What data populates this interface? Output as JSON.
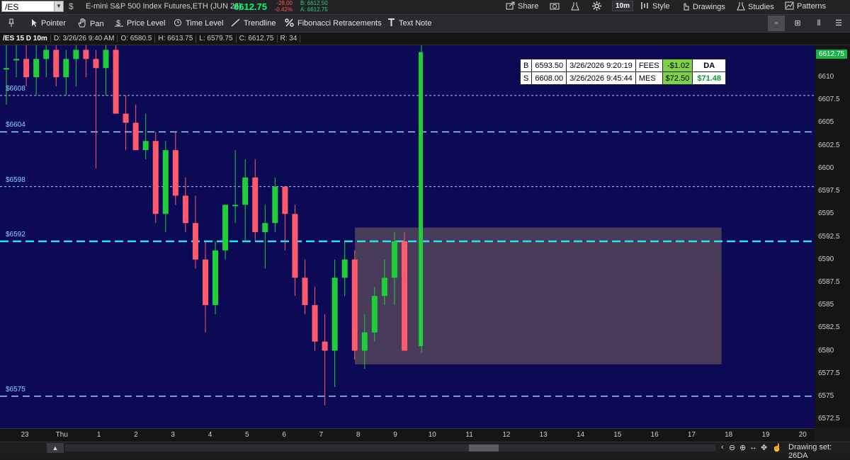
{
  "symbol": {
    "value": "/ES",
    "description": "E-mini S&P 500 Index Futures,ETH (JUN 26)"
  },
  "quote": {
    "last": "6612.75",
    "change": "-28.00",
    "change_pct": "-0.42%",
    "bid": "B: 6612.50",
    "ask": "A: 6612.75"
  },
  "header_buttons": {
    "share": "Share",
    "timeframe": "10m",
    "style": "Style",
    "drawings": "Drawings",
    "studies": "Studies",
    "patterns": "Patterns"
  },
  "tools": {
    "pointer": "Pointer",
    "pan": "Pan",
    "price_level": "Price Level",
    "time_level": "Time Level",
    "trendline": "Trendline",
    "fibonacci": "Fibonacci Retracements",
    "text_note": "Text Note"
  },
  "infobar": {
    "symbol": "/ES 15 D 10m",
    "datetime": "D: 3/26/26 9:40 AM",
    "open": "O: 6580.5",
    "high": "H: 6613.75",
    "low": "L: 6579.75",
    "close": "C: 6612.75",
    "range": "R: 34"
  },
  "levels": [
    {
      "label": "$6608",
      "price": 6608,
      "style": "dotted"
    },
    {
      "label": "$6604",
      "price": 6604,
      "style": "dashed"
    },
    {
      "label": "$6598",
      "price": 6598,
      "style": "dotted"
    },
    {
      "label": "$6592",
      "price": 6592,
      "style": "bold-dashed"
    },
    {
      "label": "$6575",
      "price": 6575,
      "style": "dashed"
    }
  ],
  "price_axis": {
    "ticks": [
      "6610",
      "6607.5",
      "6605",
      "6602.5",
      "6600",
      "6597.5",
      "6595",
      "6592.5",
      "6590",
      "6587.5",
      "6585",
      "6582.5",
      "6580",
      "6577.5",
      "6575",
      "6572.5"
    ],
    "last_badge": "6612.75"
  },
  "time_axis": {
    "ticks": [
      "23",
      "Thu",
      "1",
      "2",
      "3",
      "4",
      "5",
      "6",
      "7",
      "8",
      "9",
      "10",
      "11",
      "12",
      "13",
      "14",
      "15",
      "16",
      "17",
      "18",
      "19",
      "20"
    ]
  },
  "trade_table": {
    "rows": [
      {
        "side": "B",
        "price": "6593.50",
        "time": "3/26/2026 9:20:19",
        "tag": "FEES",
        "amount": "-$1.02",
        "extra": "DA"
      },
      {
        "side": "S",
        "price": "6608.00",
        "time": "3/26/2026 9:45:44",
        "tag": "MES",
        "amount": "$72.50",
        "extra": "$71.48"
      }
    ]
  },
  "footer": {
    "drawing_set": "Drawing set: 26DA"
  },
  "colors": {
    "plot_bg": "#0c0a54",
    "up": "#1fcf3a",
    "down": "#ff5a6b",
    "level": "#8fd4ff",
    "bold_level": "#2fe0f0",
    "zone": "#55445c"
  },
  "chart_data": {
    "type": "candlestick",
    "yrange": [
      6571.5,
      6613.5
    ],
    "x_slot_count": 21,
    "zone": {
      "price_low": 6578.5,
      "price_high": 6593.5,
      "x_start_slot": 9.15,
      "x_end_slot": 18.6
    },
    "candles": [
      {
        "o": 6611,
        "h": 6614,
        "l": 6607,
        "c": 6611
      },
      {
        "o": 6612,
        "h": 6614,
        "l": 6610,
        "c": 6612
      },
      {
        "o": 6612,
        "h": 6614,
        "l": 6609,
        "c": 6610
      },
      {
        "o": 6610,
        "h": 6614,
        "l": 6608,
        "c": 6612
      },
      {
        "o": 6612,
        "h": 6614,
        "l": 6610,
        "c": 6613
      },
      {
        "o": 6613,
        "h": 6614,
        "l": 6609,
        "c": 6610
      },
      {
        "o": 6610,
        "h": 6613,
        "l": 6608,
        "c": 6612
      },
      {
        "o": 6612,
        "h": 6614,
        "l": 6609,
        "c": 6613
      },
      {
        "o": 6613,
        "h": 6614,
        "l": 6610,
        "c": 6612
      },
      {
        "o": 6612,
        "h": 6613,
        "l": 6600,
        "c": 6611
      },
      {
        "o": 6611,
        "h": 6614,
        "l": 6608,
        "c": 6613
      },
      {
        "o": 6613,
        "h": 6614,
        "l": 6607,
        "c": 6606
      },
      {
        "o": 6606,
        "h": 6608,
        "l": 6602,
        "c": 6605
      },
      {
        "o": 6605,
        "h": 6607,
        "l": 6602,
        "c": 6602
      },
      {
        "o": 6602,
        "h": 6606,
        "l": 6601,
        "c": 6603
      },
      {
        "o": 6603,
        "h": 6604,
        "l": 6594,
        "c": 6595
      },
      {
        "o": 6595,
        "h": 6603,
        "l": 6593,
        "c": 6602
      },
      {
        "o": 6602,
        "h": 6604,
        "l": 6596,
        "c": 6597
      },
      {
        "o": 6597,
        "h": 6599,
        "l": 6593,
        "c": 6594
      },
      {
        "o": 6594,
        "h": 6597,
        "l": 6589,
        "c": 6590
      },
      {
        "o": 6590,
        "h": 6592,
        "l": 6582,
        "c": 6585
      },
      {
        "o": 6585,
        "h": 6592,
        "l": 6584,
        "c": 6591
      },
      {
        "o": 6591,
        "h": 6596,
        "l": 6590,
        "c": 6596
      },
      {
        "o": 6596,
        "h": 6602,
        "l": 6594,
        "c": 6596
      },
      {
        "o": 6596,
        "h": 6601,
        "l": 6592,
        "c": 6599
      },
      {
        "o": 6599,
        "h": 6601,
        "l": 6592,
        "c": 6593
      },
      {
        "o": 6593,
        "h": 6596,
        "l": 6589,
        "c": 6594
      },
      {
        "o": 6594,
        "h": 6599,
        "l": 6593,
        "c": 6598
      },
      {
        "o": 6598,
        "h": 6598,
        "l": 6591,
        "c": 6595
      },
      {
        "o": 6595,
        "h": 6596,
        "l": 6586,
        "c": 6588
      },
      {
        "o": 6588,
        "h": 6590,
        "l": 6584,
        "c": 6585
      },
      {
        "o": 6585,
        "h": 6587,
        "l": 6580,
        "c": 6581
      },
      {
        "o": 6581,
        "h": 6584,
        "l": 6574,
        "c": 6580
      },
      {
        "o": 6580,
        "h": 6590,
        "l": 6576,
        "c": 6588
      },
      {
        "o": 6588,
        "h": 6592,
        "l": 6586,
        "c": 6590
      },
      {
        "o": 6590,
        "h": 6591,
        "l": 6579,
        "c": 6580
      },
      {
        "o": 6580,
        "h": 6584,
        "l": 6578,
        "c": 6582
      },
      {
        "o": 6582,
        "h": 6587,
        "l": 6581,
        "c": 6586
      },
      {
        "o": 6586,
        "h": 6590,
        "l": 6585,
        "c": 6588
      },
      {
        "o": 6588,
        "h": 6593,
        "l": 6585,
        "c": 6592
      },
      {
        "o": 6592,
        "h": 6593,
        "l": 6580,
        "c": 6580
      },
      {
        "o": 6580.5,
        "h": 6613.75,
        "l": 6579.75,
        "c": 6612.75
      }
    ]
  }
}
